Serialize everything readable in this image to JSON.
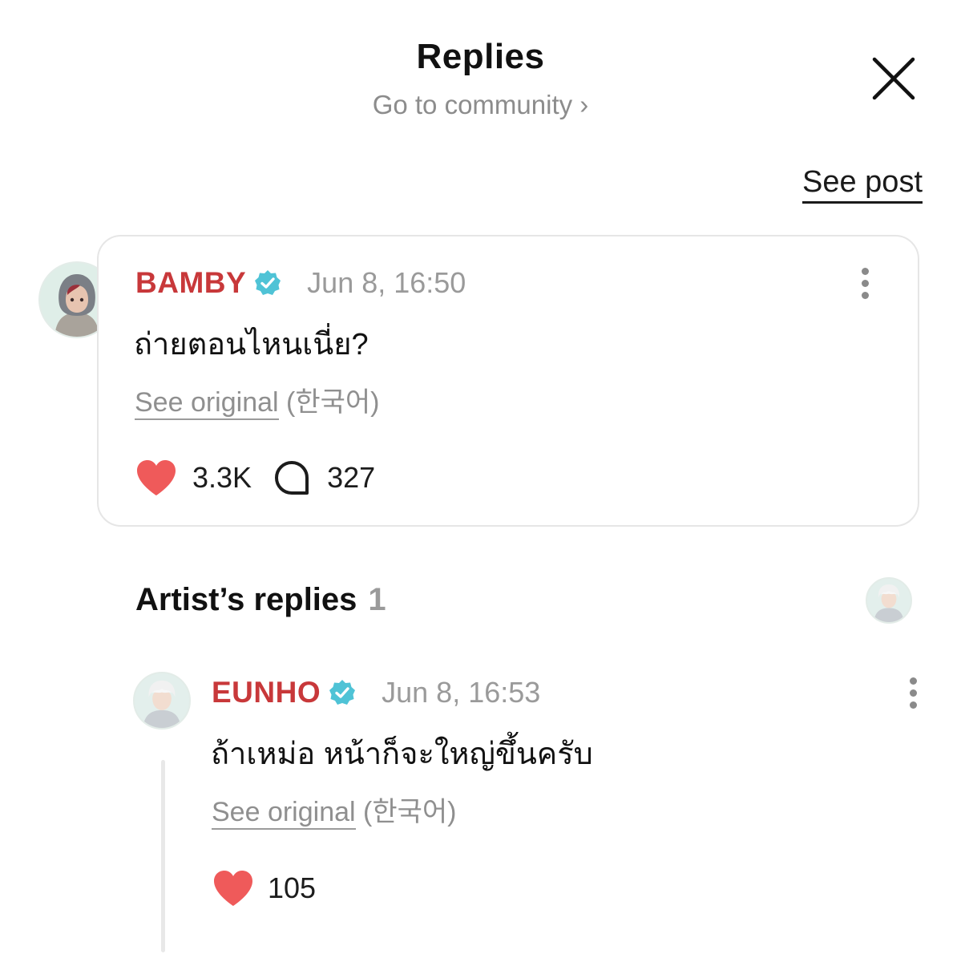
{
  "header": {
    "title": "Replies",
    "community_link": "Go to community ›"
  },
  "see_post": "See post",
  "post": {
    "username": "BAMBY",
    "verified": true,
    "timestamp": "Jun 8, 16:50",
    "text": "ถ่ายตอนไหนเนี่ย?",
    "see_original": "See original",
    "original_language": "(한국어)",
    "likes": "3.3K",
    "replies": "327"
  },
  "artist_replies": {
    "title": "Artist’s replies",
    "count": "1"
  },
  "reply": {
    "username": "EUNHO",
    "verified": true,
    "timestamp": "Jun 8, 16:53",
    "text": "ถ้าเหม่อ หน้าก็จะใหญ่ขึ้นครับ",
    "see_original": "See original",
    "original_language": "(한국어)",
    "likes": "105"
  },
  "colors": {
    "username": "#c8383a",
    "verified": "#4fc3d6",
    "heart": "#ef5a5a",
    "muted": "#8f8f8f"
  }
}
